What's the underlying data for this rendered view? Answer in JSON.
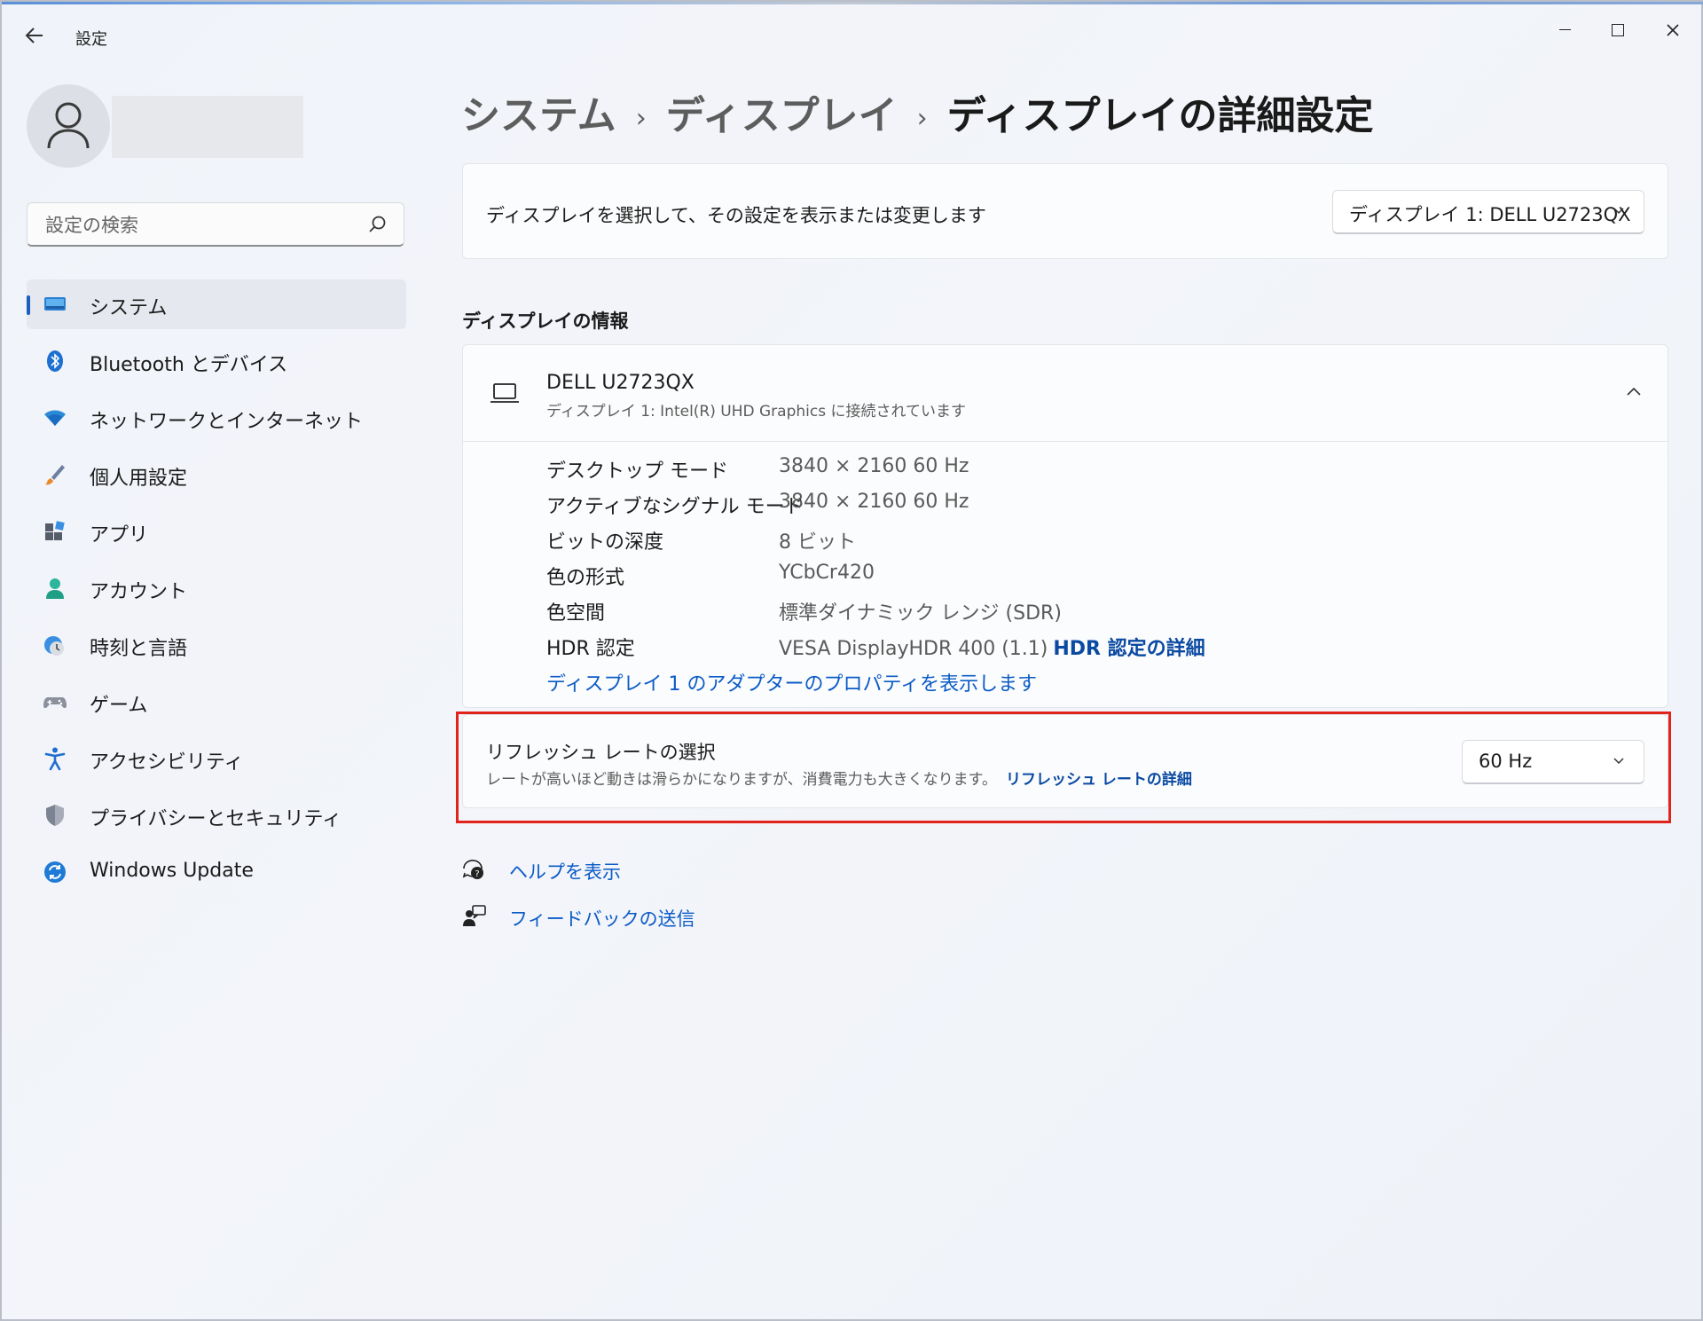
{
  "window": {
    "title": "設定"
  },
  "sidebar": {
    "search_placeholder": "設定の検索",
    "items": [
      {
        "label": "システム",
        "icon": "system-icon",
        "active": true
      },
      {
        "label": "Bluetooth とデバイス",
        "icon": "bluetooth-icon"
      },
      {
        "label": "ネットワークとインターネット",
        "icon": "wifi-icon"
      },
      {
        "label": "個人用設定",
        "icon": "brush-icon"
      },
      {
        "label": "アプリ",
        "icon": "apps-icon"
      },
      {
        "label": "アカウント",
        "icon": "account-icon"
      },
      {
        "label": "時刻と言語",
        "icon": "time-language-icon"
      },
      {
        "label": "ゲーム",
        "icon": "gamepad-icon"
      },
      {
        "label": "アクセシビリティ",
        "icon": "accessibility-icon"
      },
      {
        "label": "プライバシーとセキュリティ",
        "icon": "shield-icon"
      },
      {
        "label": "Windows Update",
        "icon": "windows-update-icon"
      }
    ]
  },
  "breadcrumb": {
    "level1": "システム",
    "level2": "ディスプレイ",
    "current": "ディスプレイの詳細設定"
  },
  "select_display": {
    "text": "ディスプレイを選択して、その設定を表示または変更します",
    "value": "ディスプレイ 1: DELL U2723QX"
  },
  "display_info": {
    "section_title": "ディスプレイの情報",
    "name": "DELL U2723QX",
    "subtitle": "ディスプレイ 1: Intel(R) UHD Graphics に接続されています",
    "rows": [
      {
        "key": "デスクトップ モード",
        "value": "3840 × 2160 60 Hz"
      },
      {
        "key": "アクティブなシグナル モード",
        "value": "3840 × 2160 60 Hz"
      },
      {
        "key": "ビットの深度",
        "value": "8 ビット"
      },
      {
        "key": "色の形式",
        "value": "YCbCr420"
      },
      {
        "key": "色空間",
        "value": "標準ダイナミック レンジ (SDR)"
      },
      {
        "key": "HDR 認定",
        "value": "VESA DisplayHDR 400 (1.1)",
        "link": "HDR 認定の詳細"
      }
    ],
    "adapter_link": "ディスプレイ 1 のアダプターのプロパティを表示します"
  },
  "refresh_rate": {
    "title": "リフレッシュ レートの選択",
    "description": "レートが高いほど動きは滑らかになりますが、消費電力も大きくなります。",
    "link": "リフレッシュ レートの詳細",
    "value": "60 Hz"
  },
  "footer_links": {
    "help": "ヘルプを表示",
    "feedback": "フィードバックの送信"
  },
  "colors": {
    "accent": "#0b5bc7",
    "highlight": "#e2231a",
    "active_bar": "#1d5fbf"
  }
}
